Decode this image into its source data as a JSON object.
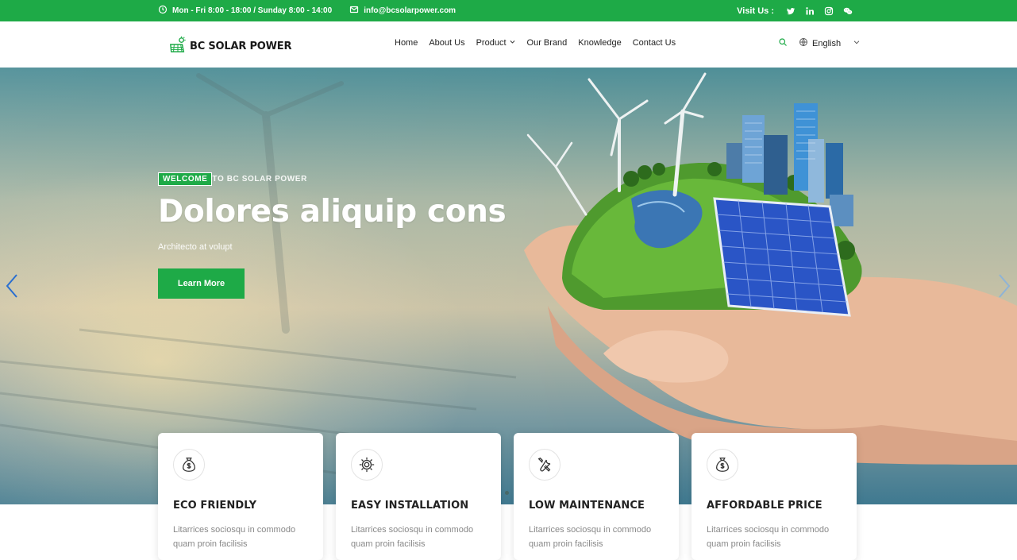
{
  "topbar": {
    "hours": "Mon - Fri 8:00 - 18:00 / Sunday 8:00 - 14:00",
    "email": "info@bcsolarpower.com",
    "visit_label": "Visit Us :",
    "social_icons": [
      "twitter-icon",
      "linkedin-icon",
      "instagram-icon",
      "wechat-icon"
    ],
    "background": "#1eaa47"
  },
  "header": {
    "logo_text": "BC SOLAR POWER",
    "nav": [
      {
        "label": "Home"
      },
      {
        "label": "About Us"
      },
      {
        "label": "Product",
        "has_dropdown": true
      },
      {
        "label": "Our Brand"
      },
      {
        "label": "Knowledge"
      },
      {
        "label": "Contact Us"
      }
    ],
    "language": "English"
  },
  "hero": {
    "welcome_badge": "WELCOME",
    "welcome_rest": "TO BC SOLAR POWER",
    "headline": "Dolores aliquip cons",
    "subline": "Architecto at volupt",
    "cta": "Learn More"
  },
  "features": [
    {
      "icon": "money-bag-icon",
      "title": "ECO FRIENDLY",
      "desc": "Litarrices sociosqu in commodo quam proin facilisis"
    },
    {
      "icon": "gear-icon",
      "title": "EASY INSTALLATION",
      "desc": "Litarrices sociosqu in commodo quam proin facilisis"
    },
    {
      "icon": "tools-icon",
      "title": "LOW MAINTENANCE",
      "desc": "Litarrices sociosqu in commodo quam proin facilisis"
    },
    {
      "icon": "money-bag-icon",
      "title": "AFFORDABLE PRICE",
      "desc": "Litarrices sociosqu in commodo quam proin facilisis"
    }
  ],
  "colors": {
    "accent": "#1eaa47",
    "text": "#222222",
    "muted": "#888888"
  }
}
